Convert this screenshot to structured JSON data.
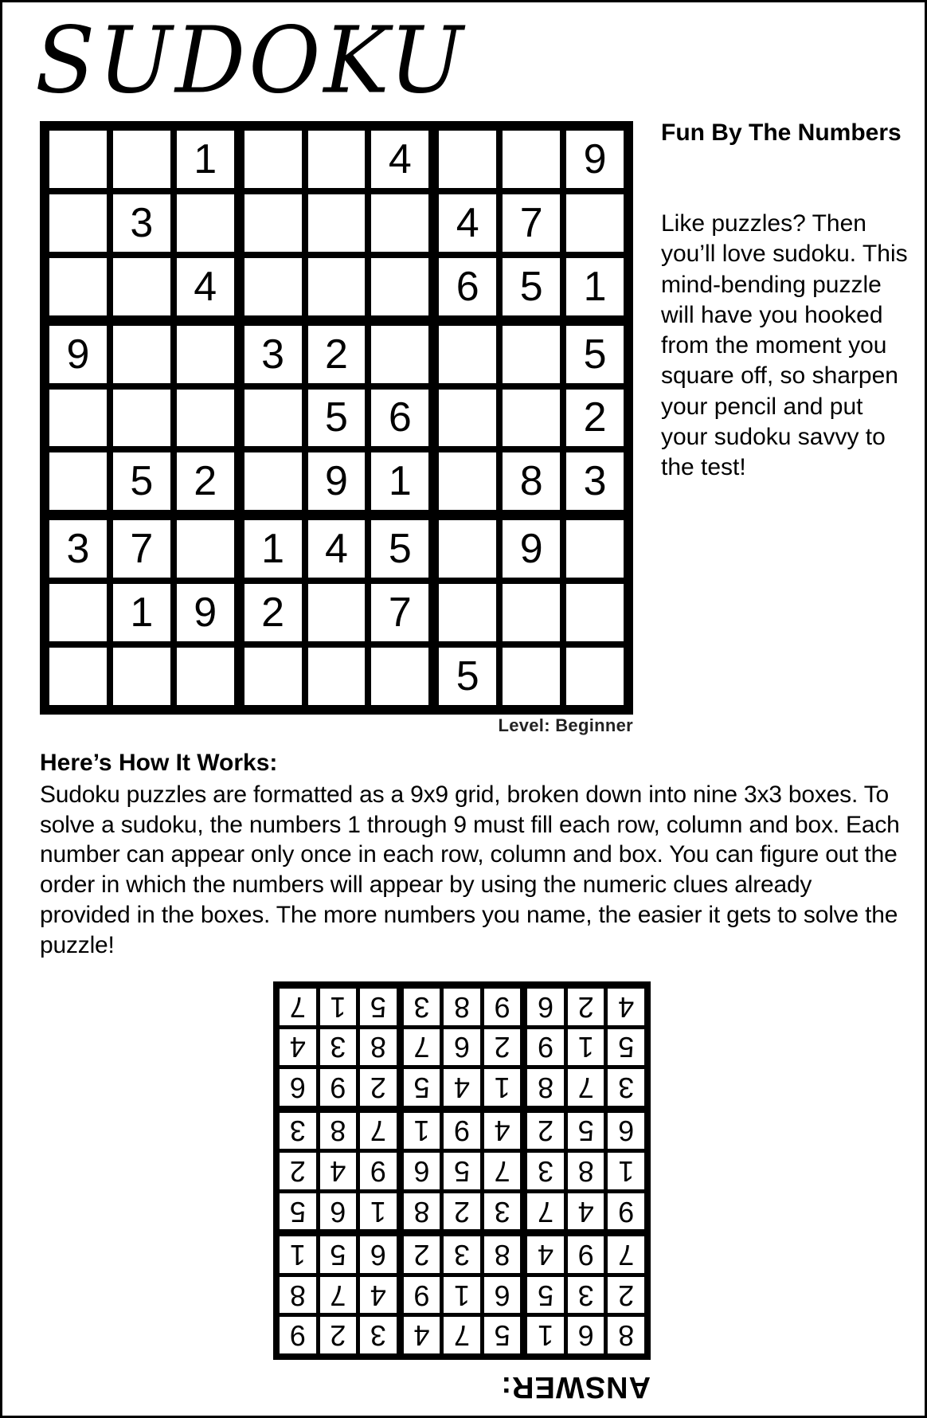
{
  "title": "SUDOKU",
  "puzzle": {
    "level_label": "Level: Beginner",
    "grid": [
      [
        null,
        null,
        1,
        null,
        null,
        4,
        null,
        null,
        9
      ],
      [
        null,
        3,
        null,
        null,
        null,
        null,
        4,
        7,
        null
      ],
      [
        null,
        null,
        4,
        null,
        null,
        null,
        6,
        5,
        1
      ],
      [
        9,
        null,
        null,
        3,
        2,
        null,
        null,
        null,
        5
      ],
      [
        null,
        null,
        null,
        null,
        5,
        6,
        null,
        null,
        2
      ],
      [
        null,
        5,
        2,
        null,
        9,
        1,
        null,
        8,
        3
      ],
      [
        3,
        7,
        null,
        1,
        4,
        5,
        null,
        9,
        null
      ],
      [
        null,
        1,
        9,
        2,
        null,
        7,
        null,
        null,
        null
      ],
      [
        null,
        null,
        null,
        null,
        null,
        null,
        5,
        null,
        null
      ]
    ]
  },
  "sidebar": {
    "heading": "Fun By The Numbers",
    "body": "Like puzzles? Then you’ll love sudoku. This mind-bending puzzle will have you hooked from the moment you square off, so sharpen your pencil and put your sudoku savvy to the test!"
  },
  "instructions": {
    "heading": "Here’s How It Works:",
    "body": "Sudoku puzzles are formatted as a 9x9 grid, broken down into nine 3x3 boxes. To solve a sudoku, the numbers 1 through 9 must fill each row, column and box. Each number can appear only once in each row, column and box. You can figure out the order in which the numbers will appear by using the numeric clues already provided in the boxes. The more numbers you name, the easier it gets to solve the puzzle!"
  },
  "answer": {
    "label": "ANSWER:",
    "orientation": "upside-down",
    "grid": [
      [
        8,
        6,
        1,
        5,
        7,
        4,
        3,
        2,
        9
      ],
      [
        2,
        3,
        5,
        6,
        1,
        9,
        4,
        7,
        8
      ],
      [
        7,
        9,
        4,
        8,
        3,
        2,
        6,
        5,
        1
      ],
      [
        9,
        4,
        7,
        3,
        2,
        8,
        1,
        6,
        5
      ],
      [
        1,
        8,
        3,
        7,
        5,
        6,
        9,
        4,
        2
      ],
      [
        6,
        5,
        2,
        4,
        9,
        1,
        7,
        8,
        3
      ],
      [
        3,
        7,
        8,
        1,
        4,
        5,
        2,
        9,
        6
      ],
      [
        5,
        1,
        9,
        2,
        6,
        7,
        8,
        3,
        4
      ],
      [
        4,
        2,
        6,
        9,
        8,
        3,
        5,
        1,
        7
      ]
    ]
  }
}
